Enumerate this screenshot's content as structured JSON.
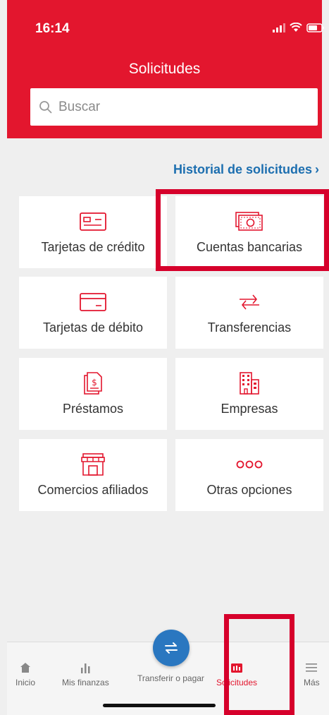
{
  "status_bar": {
    "time": "16:14"
  },
  "header": {
    "title": "Solicitudes"
  },
  "search": {
    "placeholder": "Buscar"
  },
  "history_link": {
    "label": "Historial de solicitudes",
    "chevron": "›"
  },
  "cards": [
    {
      "label": "Tarjetas de crédito",
      "icon": "credit-card-icon"
    },
    {
      "label": "Cuentas bancarias",
      "icon": "cash-icon"
    },
    {
      "label": "Tarjetas de débito",
      "icon": "debit-card-icon"
    },
    {
      "label": "Transferencias",
      "icon": "transfer-arrows-icon"
    },
    {
      "label": "Préstamos",
      "icon": "loan-document-icon"
    },
    {
      "label": "Empresas",
      "icon": "buildings-icon"
    },
    {
      "label": "Comercios afiliados",
      "icon": "store-icon"
    },
    {
      "label": "Otras opciones",
      "icon": "more-options-icon"
    }
  ],
  "tabbar": {
    "items": [
      {
        "label": "Inicio",
        "icon": "home-icon"
      },
      {
        "label": "Mis finanzas",
        "icon": "bar-chart-icon"
      },
      {
        "label": "Transferir o pagar",
        "icon": "swap-icon"
      },
      {
        "label": "Solicitudes",
        "icon": "requests-icon",
        "active": true
      },
      {
        "label": "Más",
        "icon": "menu-icon"
      }
    ]
  },
  "colors": {
    "brand_red": "#e3162e",
    "link_blue": "#1d6fb0",
    "fab_blue": "#2a77c0",
    "highlight_red": "#d6002b",
    "background": "#efefef"
  }
}
